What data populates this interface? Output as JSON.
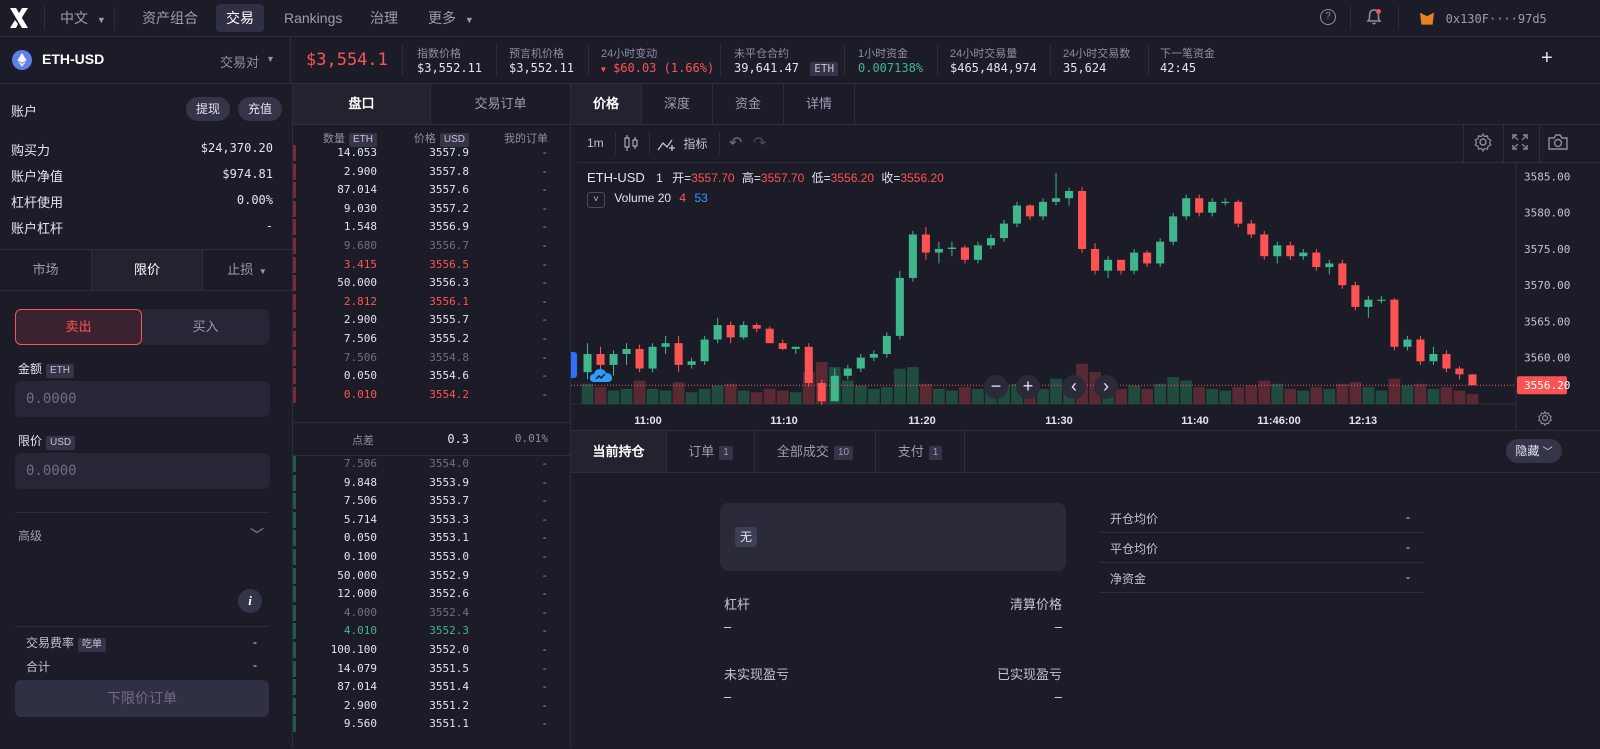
{
  "nav": {
    "lang": "中文",
    "items": [
      "资产组合",
      "交易",
      "Rankings",
      "治理",
      "更多"
    ],
    "wallet": "0x130F····97d5"
  },
  "market": {
    "pair": "ETH-USD",
    "pair_selector": "交易对",
    "price": "$3,554.1",
    "stats": [
      {
        "label": "指数价格",
        "value": "$3,552.11"
      },
      {
        "label": "预言机价格",
        "value": "$3,552.11"
      },
      {
        "label": "24小时变动",
        "value": "$60.03 (1.66%)"
      },
      {
        "label": "未平仓合约",
        "value": "39,641.47",
        "tag": "ETH"
      },
      {
        "label": "1小时资金",
        "value": "0.007138%"
      },
      {
        "label": "24小时交易量",
        "value": "$465,484,974"
      },
      {
        "label": "24小时交易数",
        "value": "35,624"
      },
      {
        "label": "下一笔资金",
        "value": "42:45"
      }
    ],
    "add": "+"
  },
  "account": {
    "title": "账户",
    "withdraw": "提现",
    "deposit": "充值",
    "rows": [
      {
        "label": "购买力",
        "value": "$24,370.20"
      },
      {
        "label": "账户净值",
        "value": "$974.81"
      },
      {
        "label": "杠杆使用",
        "value": "0.00%"
      },
      {
        "label": "账户杠杆",
        "value": "-"
      }
    ]
  },
  "order_form": {
    "tabs": [
      "市场",
      "限价",
      "止损"
    ],
    "sell": "卖出",
    "buy": "买入",
    "amount_label": "金额",
    "amount_unit": "ETH",
    "amount_placeholder": "0.0000",
    "limit_label": "限价",
    "limit_unit": "USD",
    "limit_placeholder": "0.0000",
    "advanced": "高级",
    "fee_label": "交易费率",
    "fee_tag": "吃单",
    "fee_value": "-",
    "total_label": "合计",
    "total_value": "-",
    "submit": "下限价订单",
    "info": "i"
  },
  "orderbook": {
    "tabs": [
      "盘口",
      "交易订单"
    ],
    "headers": {
      "size": "数量",
      "size_unit": "ETH",
      "price": "价格",
      "price_unit": "USD",
      "mine": "我的订单"
    },
    "asks": [
      {
        "size": "14.053",
        "price": "3557.9",
        "mine": "-"
      },
      {
        "size": "2.900",
        "price": "3557.8",
        "mine": "-"
      },
      {
        "size": "87.014",
        "price": "3557.6",
        "mine": "-"
      },
      {
        "size": "9.030",
        "price": "3557.2",
        "mine": "-"
      },
      {
        "size": "1.548",
        "price": "3556.9",
        "mine": "-"
      },
      {
        "size": "9.680",
        "price": "3556.7",
        "mine": "-",
        "dim": true
      },
      {
        "size": "3.415",
        "price": "3556.5",
        "mine": "-",
        "red": true
      },
      {
        "size": "50.000",
        "price": "3556.3",
        "mine": "-"
      },
      {
        "size": "2.812",
        "price": "3556.1",
        "mine": "-",
        "red": true
      },
      {
        "size": "2.900",
        "price": "3555.7",
        "mine": "-"
      },
      {
        "size": "7.506",
        "price": "3555.2",
        "mine": "-"
      },
      {
        "size": "7.506",
        "price": "3554.8",
        "mine": "-",
        "dim": true
      },
      {
        "size": "0.050",
        "price": "3554.6",
        "mine": "-"
      },
      {
        "size": "0.010",
        "price": "3554.2",
        "mine": "-",
        "red": true
      }
    ],
    "spread": {
      "label": "点差",
      "value": "0.3",
      "pct": "0.01%"
    },
    "bids": [
      {
        "size": "7.506",
        "price": "3554.0",
        "mine": "-",
        "dim": true
      },
      {
        "size": "9.848",
        "price": "3553.9",
        "mine": "-"
      },
      {
        "size": "7.506",
        "price": "3553.7",
        "mine": "-"
      },
      {
        "size": "5.714",
        "price": "3553.3",
        "mine": "-"
      },
      {
        "size": "0.050",
        "price": "3553.1",
        "mine": "-"
      },
      {
        "size": "0.100",
        "price": "3553.0",
        "mine": "-"
      },
      {
        "size": "50.000",
        "price": "3552.9",
        "mine": "-"
      },
      {
        "size": "12.000",
        "price": "3552.6",
        "mine": "-"
      },
      {
        "size": "4.000",
        "price": "3552.4",
        "mine": "-",
        "dim": true
      },
      {
        "size": "4.010",
        "price": "3552.3",
        "mine": "-",
        "green": true
      },
      {
        "size": "100.100",
        "price": "3552.0",
        "mine": "-"
      },
      {
        "size": "14.079",
        "price": "3551.5",
        "mine": "-"
      },
      {
        "size": "87.014",
        "price": "3551.4",
        "mine": "-"
      },
      {
        "size": "2.900",
        "price": "3551.2",
        "mine": "-"
      },
      {
        "size": "9.560",
        "price": "3551.1",
        "mine": "-"
      }
    ]
  },
  "chart_tabs": [
    "价格",
    "深度",
    "资金",
    "详情"
  ],
  "chart_toolbar": {
    "interval": "1m",
    "indicators": "指标"
  },
  "chart_legend": {
    "symbol": "ETH-USD",
    "interval": "1",
    "open_label": "开=",
    "open": "3557.70",
    "high_label": "高=",
    "high": "3557.70",
    "low_label": "低=",
    "low": "3556.20",
    "close_label": "收=",
    "close": "3556.20",
    "volume_label": "Volume 20",
    "vol_a": "4",
    "vol_b": "53"
  },
  "chart_data": {
    "type": "candlestick",
    "title": "ETH-USD 1",
    "ylim": [
      3552.5,
      3587
    ],
    "y_ticks": [
      "3585.00",
      "3580.00",
      "3575.00",
      "3570.00",
      "3565.00",
      "3560.00"
    ],
    "current_price": "3556.20",
    "x_ticks": [
      "11:00",
      "11:10",
      "11:20",
      "11:30",
      "11:40",
      "11:46:00",
      "12:13"
    ],
    "candles": [
      [
        3558.0,
        3562.0,
        3557.0,
        3560.5
      ],
      [
        3560.5,
        3561.5,
        3558.0,
        3559.0
      ],
      [
        3559.0,
        3561.0,
        3557.5,
        3560.5
      ],
      [
        3560.5,
        3562.0,
        3559.0,
        3561.2
      ],
      [
        3561.2,
        3561.8,
        3558.0,
        3558.5
      ],
      [
        3558.5,
        3562.0,
        3558.0,
        3561.5
      ],
      [
        3561.5,
        3563.0,
        3560.5,
        3562.0
      ],
      [
        3562.0,
        3563.0,
        3558.0,
        3559.0
      ],
      [
        3559.0,
        3560.0,
        3558.5,
        3559.5
      ],
      [
        3559.5,
        3563.0,
        3559.0,
        3562.5
      ],
      [
        3562.5,
        3565.5,
        3562.0,
        3564.5
      ],
      [
        3564.5,
        3565.0,
        3562.0,
        3562.8
      ],
      [
        3562.8,
        3565.0,
        3562.5,
        3564.5
      ],
      [
        3564.5,
        3564.8,
        3563.5,
        3564.0
      ],
      [
        3564.0,
        3564.3,
        3562.0,
        3562.0
      ],
      [
        3562.0,
        3562.5,
        3561.0,
        3561.2
      ],
      [
        3561.2,
        3561.5,
        3560.5,
        3561.5
      ],
      [
        3561.5,
        3562.0,
        3556.0,
        3556.5
      ],
      [
        3556.5,
        3557.0,
        3553.5,
        3554.0
      ],
      [
        3554.0,
        3558.5,
        3554.0,
        3557.5
      ],
      [
        3557.5,
        3559.0,
        3557.0,
        3558.5
      ],
      [
        3558.5,
        3560.5,
        3558.0,
        3560.0
      ],
      [
        3560.0,
        3561.0,
        3559.5,
        3560.5
      ],
      [
        3560.5,
        3563.5,
        3560.0,
        3563.0
      ],
      [
        3563.0,
        3572.0,
        3562.5,
        3571.0
      ],
      [
        3571.0,
        3577.5,
        3570.5,
        3577.0
      ],
      [
        3577.0,
        3578.0,
        3573.5,
        3574.5
      ],
      [
        3574.5,
        3576.0,
        3573.0,
        3575.0
      ],
      [
        3575.0,
        3576.0,
        3574.0,
        3575.2
      ],
      [
        3575.2,
        3575.5,
        3573.0,
        3573.5
      ],
      [
        3573.5,
        3576.0,
        3573.0,
        3575.5
      ],
      [
        3575.5,
        3577.0,
        3575.0,
        3576.5
      ],
      [
        3576.5,
        3579.0,
        3576.0,
        3578.5
      ],
      [
        3578.5,
        3581.5,
        3578.0,
        3581.0
      ],
      [
        3581.0,
        3581.2,
        3579.0,
        3579.5
      ],
      [
        3579.5,
        3582.0,
        3579.0,
        3581.5
      ],
      [
        3581.5,
        3585.5,
        3581.0,
        3582.0
      ],
      [
        3582.0,
        3583.5,
        3581.0,
        3583.0
      ],
      [
        3583.0,
        3583.5,
        3574.5,
        3575.0
      ],
      [
        3575.0,
        3575.8,
        3571.5,
        3572.0
      ],
      [
        3572.0,
        3574.0,
        3571.0,
        3573.5
      ],
      [
        3573.5,
        3573.5,
        3571.5,
        3572.0
      ],
      [
        3572.0,
        3575.0,
        3571.5,
        3574.5
      ],
      [
        3574.5,
        3574.8,
        3572.5,
        3573.0
      ],
      [
        3573.0,
        3576.5,
        3572.5,
        3576.0
      ],
      [
        3576.0,
        3580.0,
        3575.5,
        3579.5
      ],
      [
        3579.5,
        3582.5,
        3579.0,
        3582.0
      ],
      [
        3582.0,
        3582.5,
        3579.5,
        3580.0
      ],
      [
        3580.0,
        3582.0,
        3579.5,
        3581.5
      ],
      [
        3581.5,
        3582.0,
        3581.0,
        3581.5
      ],
      [
        3581.5,
        3581.8,
        3578.0,
        3578.5
      ],
      [
        3578.5,
        3579.0,
        3576.5,
        3577.0
      ],
      [
        3577.0,
        3577.5,
        3573.5,
        3574.0
      ],
      [
        3574.0,
        3576.0,
        3573.0,
        3575.5
      ],
      [
        3575.5,
        3576.0,
        3573.5,
        3574.0
      ],
      [
        3574.0,
        3575.0,
        3573.5,
        3574.5
      ],
      [
        3574.5,
        3575.0,
        3572.0,
        3572.5
      ],
      [
        3572.5,
        3573.5,
        3571.5,
        3573.0
      ],
      [
        3573.0,
        3573.5,
        3569.5,
        3570.0
      ],
      [
        3570.0,
        3570.5,
        3566.5,
        3567.0
      ],
      [
        3567.0,
        3568.5,
        3565.5,
        3568.0
      ],
      [
        3568.0,
        3568.5,
        3567.5,
        3568.0
      ],
      [
        3568.0,
        3568.2,
        3561.0,
        3561.5
      ],
      [
        3561.5,
        3563.0,
        3561.0,
        3562.5
      ],
      [
        3562.5,
        3563.0,
        3559.0,
        3559.5
      ],
      [
        3559.5,
        3561.5,
        3559.0,
        3560.5
      ],
      [
        3560.5,
        3561.0,
        3558.0,
        3558.5
      ],
      [
        3558.5,
        3558.8,
        3557.0,
        3557.7
      ],
      [
        3557.7,
        3557.7,
        3556.2,
        3556.2
      ]
    ],
    "volumes": [
      12,
      10,
      8,
      9,
      14,
      9,
      8,
      13,
      7,
      9,
      11,
      12,
      8,
      7,
      9,
      8,
      7,
      19,
      25,
      22,
      14,
      11,
      9,
      10,
      21,
      22,
      12,
      9,
      8,
      10,
      9,
      10,
      11,
      12,
      8,
      9,
      15,
      10,
      24,
      19,
      12,
      9,
      11,
      9,
      12,
      16,
      14,
      10,
      9,
      8,
      10,
      11,
      14,
      12,
      9,
      8,
      10,
      9,
      12,
      13,
      10,
      8,
      15,
      11,
      12,
      9,
      10,
      8,
      6
    ]
  },
  "chart_overlay": {
    "minus": "−",
    "plus": "+",
    "prev": "‹",
    "next": "›"
  },
  "positions": {
    "tabs": [
      {
        "label": "当前持仓",
        "count": ""
      },
      {
        "label": "订单",
        "count": "1"
      },
      {
        "label": "全部成交",
        "count": "10"
      },
      {
        "label": "支付",
        "count": "1"
      }
    ],
    "hide": "隐藏",
    "empty": "无",
    "leverage_label": "杠杆",
    "leverage_value": "–",
    "liq_label": "清算价格",
    "liq_value": "–",
    "unrealized_label": "未实现盈亏",
    "unrealized_value": "–",
    "realized_label": "已实现盈亏",
    "realized_value": "–",
    "side": [
      {
        "label": "开仓均价",
        "value": "-"
      },
      {
        "label": "平仓均价",
        "value": "-"
      },
      {
        "label": "净资金",
        "value": "-"
      }
    ]
  },
  "colors": {
    "green": "#3fb68b",
    "red": "#ff5353",
    "accent": "#5973fe",
    "bg": "#1c1c28"
  }
}
